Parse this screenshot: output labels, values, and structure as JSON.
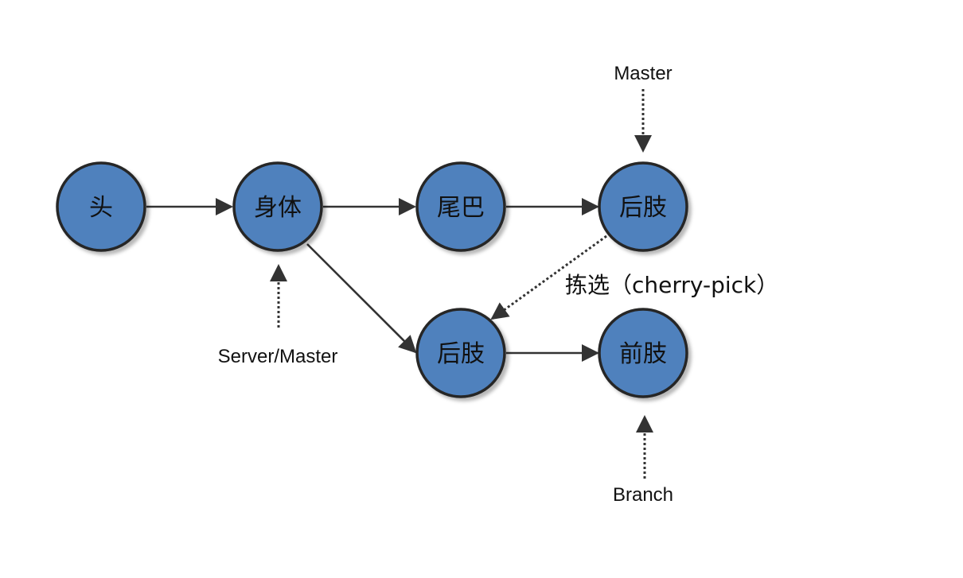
{
  "nodes": [
    {
      "id": "head",
      "label": "头"
    },
    {
      "id": "body",
      "label": "身体"
    },
    {
      "id": "tail",
      "label": "尾巴"
    },
    {
      "id": "hindlimb-master",
      "label": "后肢"
    },
    {
      "id": "hindlimb-branch",
      "label": "后肢"
    },
    {
      "id": "forelimb",
      "label": "前肢"
    }
  ],
  "pointers": [
    {
      "id": "master",
      "label": "Master",
      "target": "hindlimb-master"
    },
    {
      "id": "server-master",
      "label": "Server/Master",
      "target": "body"
    },
    {
      "id": "branch",
      "label": "Branch",
      "target": "forelimb"
    }
  ],
  "edges": [
    {
      "from": "head",
      "to": "body",
      "style": "solid"
    },
    {
      "from": "body",
      "to": "tail",
      "style": "solid"
    },
    {
      "from": "tail",
      "to": "hindlimb-master",
      "style": "solid"
    },
    {
      "from": "body",
      "to": "hindlimb-branch",
      "style": "solid"
    },
    {
      "from": "hindlimb-branch",
      "to": "forelimb",
      "style": "solid"
    },
    {
      "from": "hindlimb-master",
      "to": "hindlimb-branch",
      "style": "dotted",
      "label": "拣选（cherry-pick）"
    }
  ],
  "colors": {
    "node_fill": "#4f81bd",
    "node_stroke": "#262626",
    "arrow": "#333333"
  }
}
